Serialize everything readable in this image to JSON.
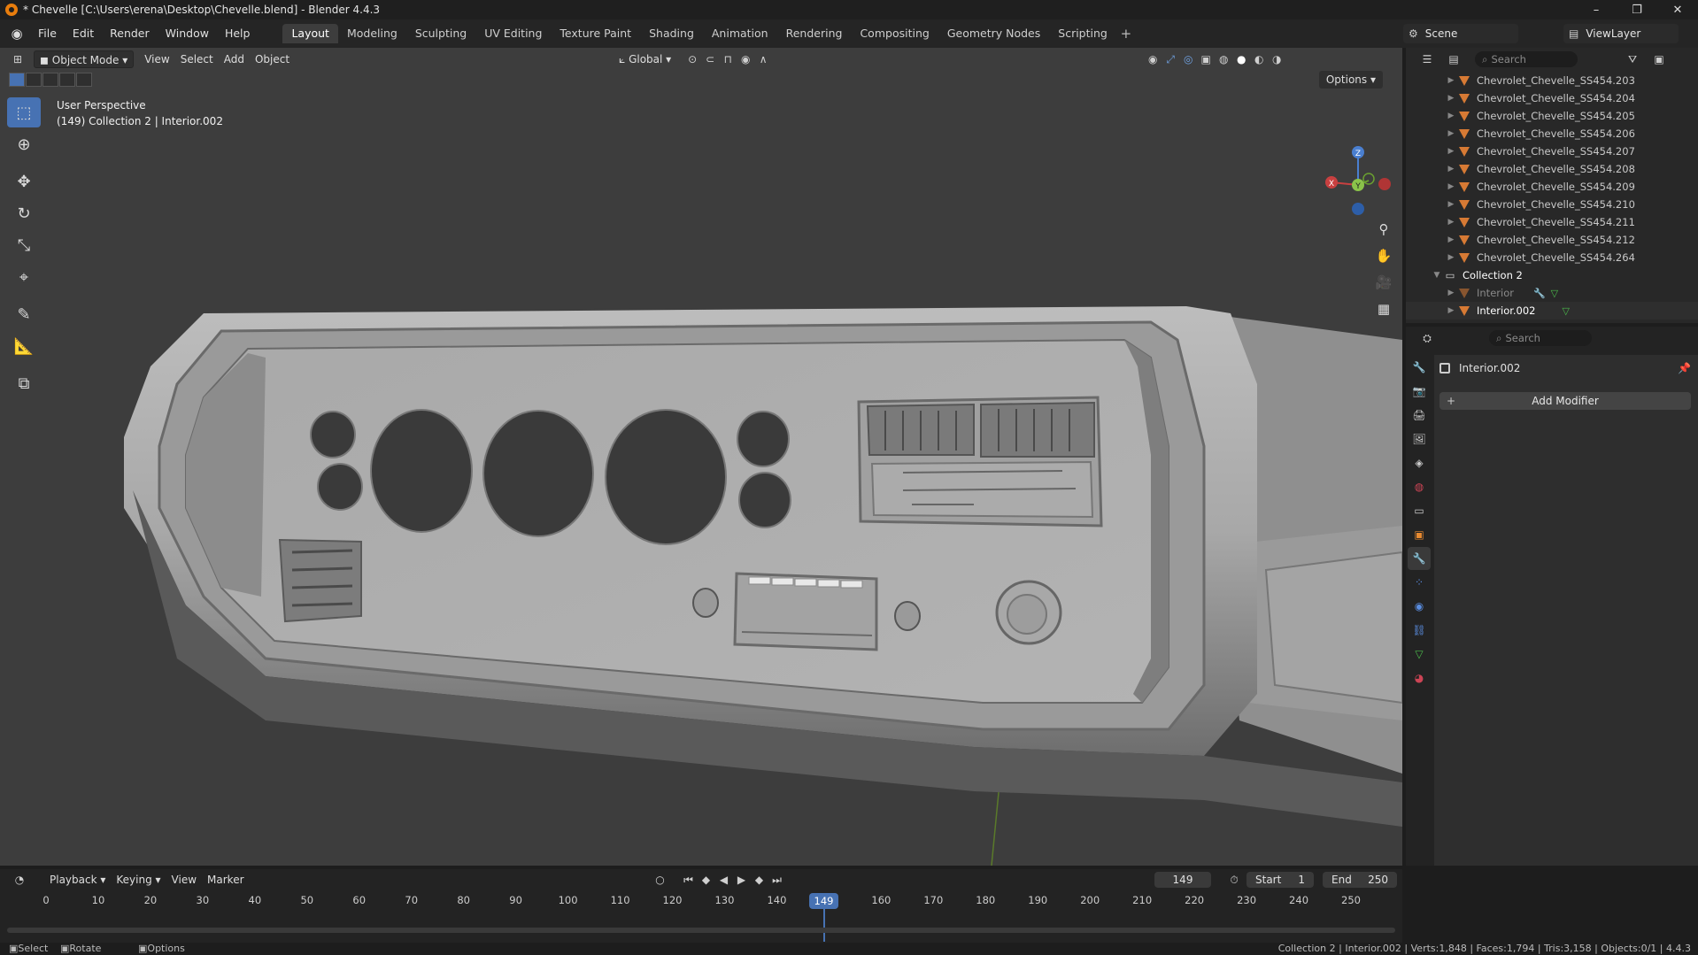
{
  "window": {
    "title": "* Chevelle [C:\\Users\\erena\\Desktop\\Chevelle.blend] - Blender 4.4.3",
    "minimize": "–",
    "maximize": "❐",
    "close": "✕"
  },
  "menu": [
    "File",
    "Edit",
    "Render",
    "Window",
    "Help"
  ],
  "workspaces": [
    "Layout",
    "Modeling",
    "Sculpting",
    "UV Editing",
    "Texture Paint",
    "Shading",
    "Animation",
    "Rendering",
    "Compositing",
    "Geometry Nodes",
    "Scripting"
  ],
  "active_workspace": "Layout",
  "scene": {
    "name": "Scene",
    "view_layer": "ViewLayer"
  },
  "viewport": {
    "mode": "Object Mode",
    "menus": [
      "View",
      "Select",
      "Add",
      "Object"
    ],
    "transform_orientation": "Global",
    "options_label": "Options",
    "info_line1": "User Perspective",
    "info_line2": "(149) Collection 2 | Interior.002",
    "gizmo_axes": {
      "z": "Z",
      "x": "X",
      "y": "Y"
    }
  },
  "outliner": {
    "search_placeholder": "Search",
    "items": [
      {
        "label": "Chevrolet_Chevelle_SS454.203",
        "type": "mesh"
      },
      {
        "label": "Chevrolet_Chevelle_SS454.204",
        "type": "mesh"
      },
      {
        "label": "Chevrolet_Chevelle_SS454.205",
        "type": "mesh"
      },
      {
        "label": "Chevrolet_Chevelle_SS454.206",
        "type": "mesh"
      },
      {
        "label": "Chevrolet_Chevelle_SS454.207",
        "type": "mesh"
      },
      {
        "label": "Chevrolet_Chevelle_SS454.208",
        "type": "mesh"
      },
      {
        "label": "Chevrolet_Chevelle_SS454.209",
        "type": "mesh"
      },
      {
        "label": "Chevrolet_Chevelle_SS454.210",
        "type": "mesh"
      },
      {
        "label": "Chevrolet_Chevelle_SS454.211",
        "type": "mesh"
      },
      {
        "label": "Chevrolet_Chevelle_SS454.212",
        "type": "mesh"
      },
      {
        "label": "Chevrolet_Chevelle_SS454.264",
        "type": "mesh"
      }
    ],
    "collection": {
      "label": "Collection 2"
    },
    "children": [
      {
        "label": "Interior",
        "hidden": true
      },
      {
        "label": "Interior.002",
        "hidden": false
      }
    ]
  },
  "properties": {
    "search_placeholder": "Search",
    "object_name": "Interior.002",
    "add_modifier": "Add Modifier"
  },
  "timeline": {
    "menus": [
      "Playback",
      "Keying",
      "View",
      "Marker"
    ],
    "current_frame": "149",
    "start_label": "Start",
    "start": "1",
    "end_label": "End",
    "end": "250",
    "ticks": [
      "0",
      "10",
      "20",
      "30",
      "40",
      "50",
      "60",
      "70",
      "80",
      "90",
      "100",
      "110",
      "120",
      "130",
      "140",
      "150",
      "160",
      "170",
      "180",
      "190",
      "200",
      "210",
      "220",
      "230",
      "240",
      "250"
    ]
  },
  "statusbar": {
    "left": [
      "Select",
      "Rotate View",
      "Options"
    ],
    "right": "Collection 2 | Interior.002 | Verts:1,848 | Faces:1,794 | Tris:3,158 | Objects:0/1 | 4.4.3"
  }
}
